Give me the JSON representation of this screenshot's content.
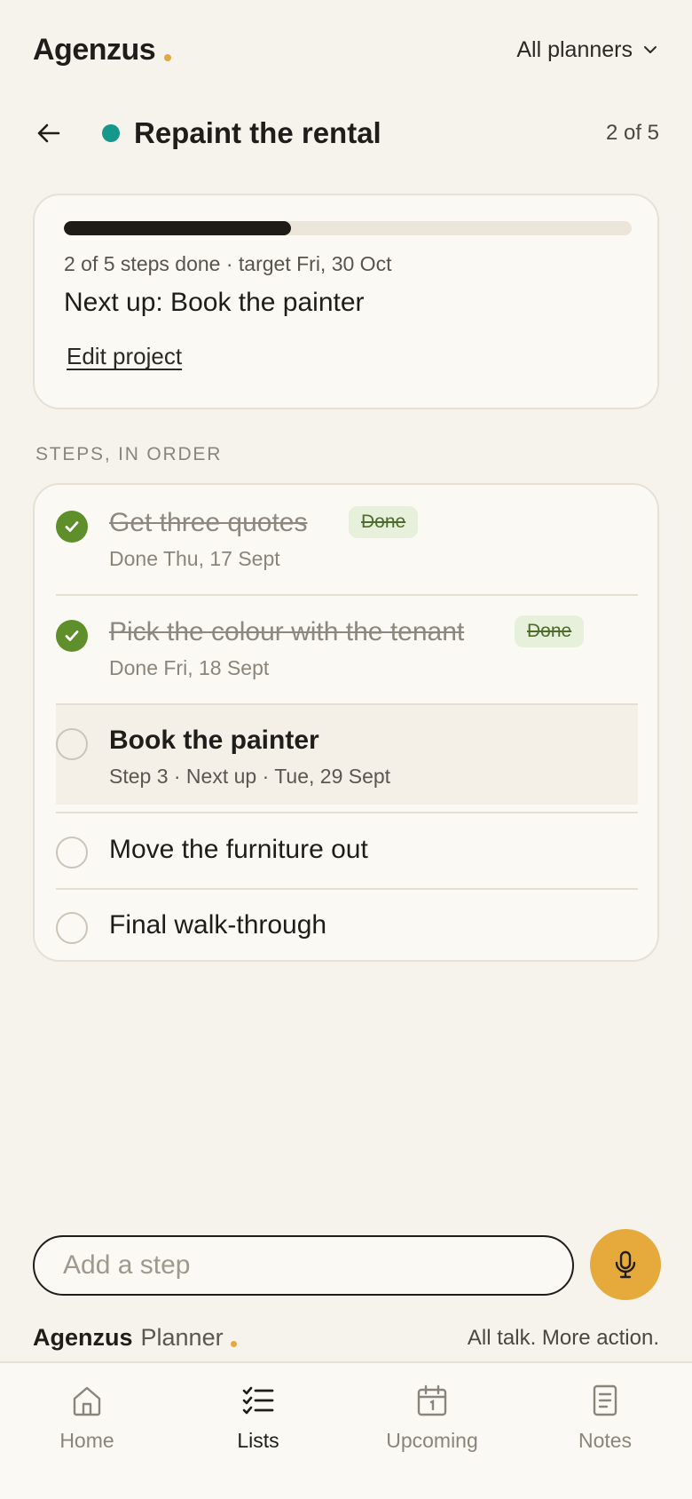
{
  "app": {
    "brand": "Agenzus",
    "planner_select": "All planners"
  },
  "project": {
    "title": "Repaint the rental",
    "position": "2 of 5",
    "status_color": "#16978b"
  },
  "summary": {
    "progress": 0.4,
    "meta": "2 of 5 steps done · target Fri, 30 Oct",
    "next_up": "Next up: Book the painter",
    "edit_label": "Edit project"
  },
  "steps_label": "STEPS, IN ORDER",
  "steps": [
    {
      "title": "Get three quotes",
      "badge": "Done",
      "sub": "Done Thu, 17 Sept",
      "done": true
    },
    {
      "title": "Pick the colour with the tenant",
      "badge": "Done",
      "sub": "Done Fri, 18 Sept",
      "done": true
    },
    {
      "title": "Book the painter",
      "sub": "Step 3 · Next up · Tue, 29 Sept",
      "done": false,
      "next": true
    },
    {
      "title": "Move the furniture out",
      "done": false
    },
    {
      "title": "Final walk-through",
      "done": false
    }
  ],
  "composer": {
    "placeholder": "Add a step",
    "mic_icon": "microphone-icon"
  },
  "footer": {
    "brand": "Agenzus",
    "product": "Planner",
    "tagline": "All talk. More action."
  },
  "nav": [
    {
      "label": "Home",
      "icon": "home-icon",
      "active": false
    },
    {
      "label": "Lists",
      "icon": "checklist-icon",
      "active": true
    },
    {
      "label": "Upcoming",
      "icon": "calendar-icon",
      "active": false
    },
    {
      "label": "Notes",
      "icon": "notes-icon",
      "active": false
    }
  ],
  "colors": {
    "accent": "#e6a93c",
    "done_green": "#5e8f2a",
    "background": "#f6f3ec"
  }
}
